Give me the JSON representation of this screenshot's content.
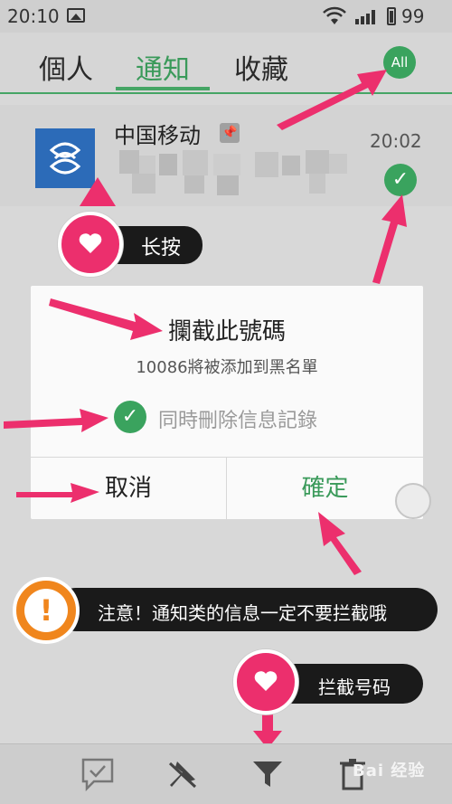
{
  "status_bar": {
    "time": "20:10",
    "battery": "99"
  },
  "tabs": [
    {
      "label": "個人"
    },
    {
      "label": "通知"
    },
    {
      "label": "收藏"
    }
  ],
  "all_button": "All",
  "message": {
    "sender": "中国移动",
    "time": "20:02"
  },
  "dialog": {
    "title": "攔截此號碼",
    "message": "10086將被添加到黑名單",
    "checkbox_label": "同時刪除信息記錄",
    "cancel": "取消",
    "confirm": "確定"
  },
  "annotations": {
    "long_press": "长按",
    "warning": "注意！通知类的信息一定不要拦截哦",
    "block_number": "拦截号码",
    "warning_mark": "!"
  },
  "watermark": "Bai 经验",
  "colors": {
    "accent_green": "#3aa35e",
    "annotation_pink": "#ec2f6d",
    "warning_orange": "#f0861d"
  }
}
